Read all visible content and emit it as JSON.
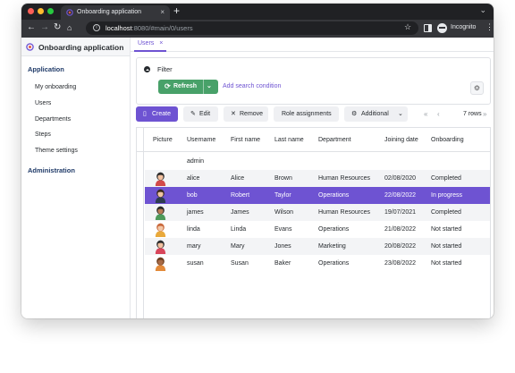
{
  "browser": {
    "tab_title": "Onboarding application",
    "tab_close": "×",
    "new_tab": "+",
    "url_host": "localhost",
    "url_path": ":8080/#main/0/users",
    "profile": "Incognito"
  },
  "app": {
    "title": "Onboarding application",
    "view_tab": "Users",
    "view_tab_close": "×"
  },
  "sidebar": {
    "sections": [
      {
        "title": "Application",
        "items": [
          "My onboarding",
          "Users",
          "Departments",
          "Steps",
          "Theme settings"
        ]
      },
      {
        "title": "Administration",
        "items": []
      }
    ]
  },
  "filter": {
    "label": "Filter",
    "refresh_label": "Refresh",
    "add_condition": "Add search condition"
  },
  "toolbar": {
    "create": "Create",
    "edit": "Edit",
    "remove": "Remove",
    "role_assignments": "Role assignments",
    "additional": "Additional",
    "rows": "7 rows"
  },
  "table": {
    "columns": [
      "Picture",
      "Username",
      "First name",
      "Last name",
      "Department",
      "Joining date",
      "Onboarding"
    ],
    "rows": [
      {
        "username": "admin",
        "first_name": "",
        "last_name": "",
        "department": "",
        "joining_date": "",
        "onboarding": "",
        "selected": false,
        "has_avatar": false
      },
      {
        "username": "alice",
        "first_name": "Alice",
        "last_name": "Brown",
        "department": "Human Resources",
        "joining_date": "02/08/2020",
        "onboarding": "Completed",
        "selected": false,
        "has_avatar": true,
        "hair": "#2b2b2b",
        "shirt": "#d24a4a",
        "skin": "#f2c1a0"
      },
      {
        "username": "bob",
        "first_name": "Robert",
        "last_name": "Taylor",
        "department": "Operations",
        "joining_date": "22/08/2022",
        "onboarding": "In progress",
        "selected": true,
        "has_avatar": true,
        "hair": "#3a2a1e",
        "shirt": "#2d3b4f",
        "skin": "#f0c4a3"
      },
      {
        "username": "james",
        "first_name": "James",
        "last_name": "Wilson",
        "department": "Human Resources",
        "joining_date": "19/07/2021",
        "onboarding": "Completed",
        "selected": false,
        "has_avatar": true,
        "hair": "#2a2a2a",
        "shirt": "#4e9a5b",
        "skin": "#b87c55"
      },
      {
        "username": "linda",
        "first_name": "Linda",
        "last_name": "Evans",
        "department": "Operations",
        "joining_date": "21/08/2022",
        "onboarding": "Not started",
        "selected": false,
        "has_avatar": true,
        "hair": "#c9683b",
        "shirt": "#e9a93b",
        "skin": "#f2c8a8"
      },
      {
        "username": "mary",
        "first_name": "Mary",
        "last_name": "Jones",
        "department": "Marketing",
        "joining_date": "20/08/2022",
        "onboarding": "Not started",
        "selected": false,
        "has_avatar": true,
        "hair": "#2b2b2b",
        "shirt": "#d8455a",
        "skin": "#f2c1a0"
      },
      {
        "username": "susan",
        "first_name": "Susan",
        "last_name": "Baker",
        "department": "Operations",
        "joining_date": "23/08/2022",
        "onboarding": "Not started",
        "selected": false,
        "has_avatar": true,
        "hair": "#6b3d1f",
        "shirt": "#e38a3a",
        "skin": "#a86a45"
      }
    ]
  },
  "colors": {
    "accent": "#6e53d2",
    "refresh_green": "#48a169",
    "sidebar_section": "#1f3a68"
  }
}
